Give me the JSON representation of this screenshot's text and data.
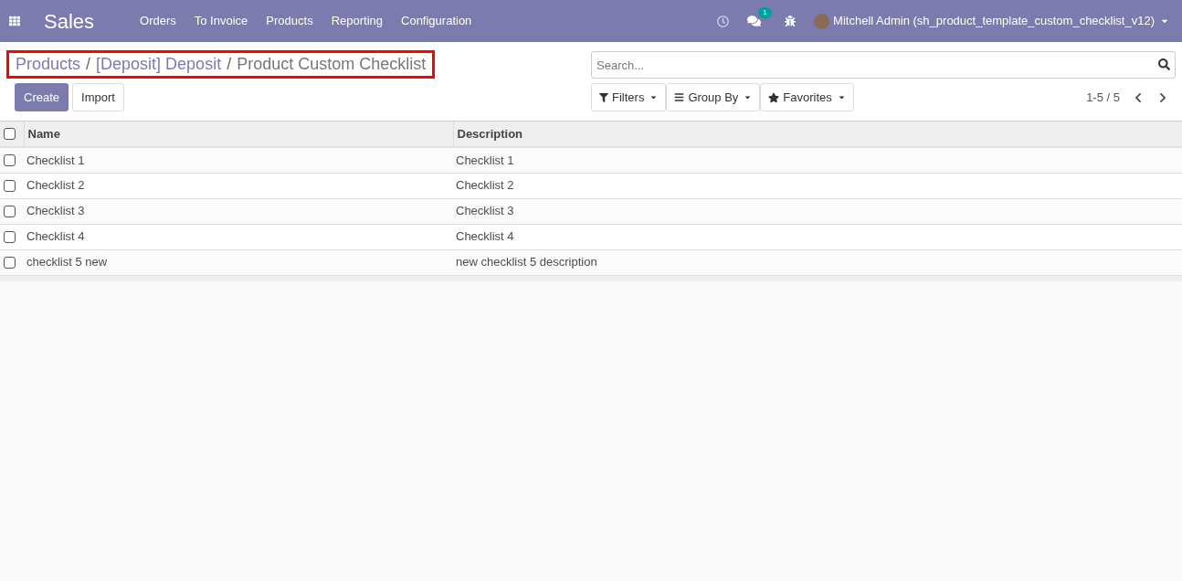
{
  "navbar": {
    "app_name": "Sales",
    "menu": [
      "Orders",
      "To Invoice",
      "Products",
      "Reporting",
      "Configuration"
    ],
    "messages_badge": "1",
    "user": "Mitchell Admin (sh_product_template_custom_checklist_v12)"
  },
  "breadcrumb": {
    "links": [
      "Products",
      "[Deposit] Deposit"
    ],
    "separator": "/",
    "current": "Product Custom Checklist",
    "highlighted": true
  },
  "buttons": {
    "create": "Create",
    "import": "Import"
  },
  "search": {
    "placeholder": "Search..."
  },
  "filters": [
    {
      "kind": "filter",
      "label": "Filters"
    },
    {
      "kind": "group",
      "label": "Group By"
    },
    {
      "kind": "favorite",
      "label": "Favorites"
    }
  ],
  "pager": "1-5 / 5",
  "table": {
    "select_all_checked": false,
    "columns": [
      "Name",
      "Description"
    ],
    "rows": [
      {
        "name": "Checklist 1",
        "description": "Checklist 1",
        "checked": false
      },
      {
        "name": "Checklist 2",
        "description": "Checklist 2",
        "checked": false
      },
      {
        "name": "Checklist 3",
        "description": "Checklist 3",
        "checked": false
      },
      {
        "name": "Checklist 4",
        "description": "Checklist 4",
        "checked": false
      },
      {
        "name": "checklist 5 new",
        "description": "new checklist 5 description",
        "checked": false
      }
    ]
  }
}
